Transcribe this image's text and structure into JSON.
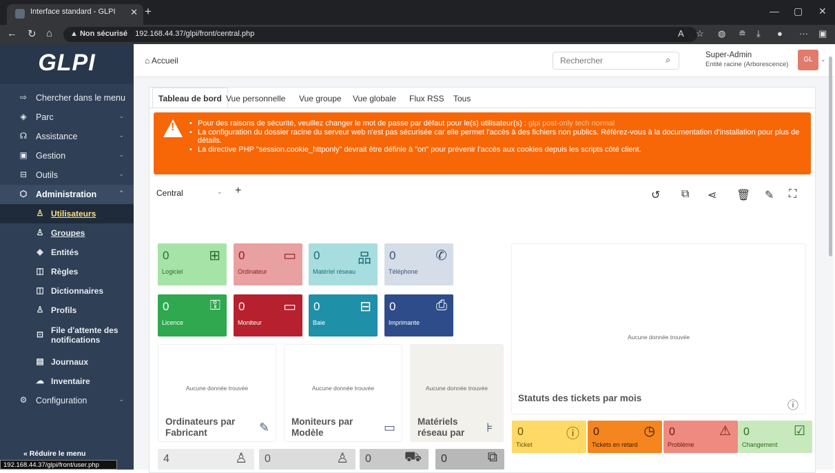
{
  "browser": {
    "tab_title": "Interface standard - GLPI",
    "url_prefix": "Non sécurisé",
    "url": "192.168.44.37/glpi/front/central.php",
    "status_url": "192.168.44.37/glpi/front/user.php"
  },
  "sidebar": {
    "logo": "GLPI",
    "search_label": "Chercher dans le menu",
    "items": [
      {
        "label": "Parc"
      },
      {
        "label": "Assistance"
      },
      {
        "label": "Gestion"
      },
      {
        "label": "Outils"
      },
      {
        "label": "Administration"
      }
    ],
    "admin_sub": [
      {
        "label": "Utilisateurs"
      },
      {
        "label": "Groupes"
      },
      {
        "label": "Entités"
      },
      {
        "label": "Règles"
      },
      {
        "label": "Dictionnaires"
      },
      {
        "label": "Profils"
      },
      {
        "label": "File d'attente des notifications"
      },
      {
        "label": "Journaux"
      },
      {
        "label": "Inventaire"
      }
    ],
    "config_label": "Configuration",
    "reduce_label": "Réduire le menu"
  },
  "header": {
    "breadcrumb": "Accueil",
    "search_placeholder": "Rechercher",
    "user_name": "Super-Admin",
    "user_entity": "Entité racine (Arborescence)",
    "avatar_initials": "GL"
  },
  "tabs": [
    "Tableau de bord",
    "Vue personnelle",
    "Vue groupe",
    "Vue globale",
    "Flux RSS",
    "Tous"
  ],
  "alert": {
    "line1_pre": "Pour des raisons de sécurité, veuillez changer le mot de passe par défaut pour le(s) utilisateur(s) :",
    "line1_users": "glpi post-only tech normal",
    "line2": "La configuration du dossier racine du serveur web n'est pas sécurisée car elle permet l'accès à des fichiers non publics. Référez-vous à la documentation d'installation pour plus de détails.",
    "line3": "La directive PHP \"session.cookie_httponly\" devrait être définie à \"on\" pour prévenir l'accès aux cookies depuis les scripts côté client."
  },
  "dashboard": {
    "selected": "Central",
    "tiles": [
      {
        "value": "0",
        "label": "Logiciel",
        "color": "#a6e3a6"
      },
      {
        "value": "0",
        "label": "Ordinateur",
        "color": "#e8a0a0"
      },
      {
        "value": "0",
        "label": "Matériel réseau",
        "color": "#a8dde0"
      },
      {
        "value": "0",
        "label": "Téléphone",
        "color": "#d4dde8"
      },
      {
        "value": "0",
        "label": "Licence",
        "color": "#2fa84f"
      },
      {
        "value": "0",
        "label": "Moniteur",
        "color": "#b7202e"
      },
      {
        "value": "0",
        "label": "Baie",
        "color": "#1e90a8"
      },
      {
        "value": "0",
        "label": "Imprimante",
        "color": "#2e4c8a"
      }
    ],
    "empty_msg": "Aucune donnée trouvée",
    "cards": [
      {
        "title": "Ordinateurs par Fabricant"
      },
      {
        "title": "Moniteurs par Modèle"
      },
      {
        "title": "Matériels réseau par"
      }
    ],
    "big_chart_title": "Statuts des tickets par mois",
    "ticket_tiles": [
      {
        "value": "0",
        "label": "Ticket",
        "color": "#ffd966"
      },
      {
        "value": "0",
        "label": "Tickets en retard",
        "color": "#f5851f"
      },
      {
        "value": "0",
        "label": "Problème",
        "color": "#ef8a80"
      },
      {
        "value": "0",
        "label": "Changement",
        "color": "#c8e8bd"
      }
    ],
    "grey_tiles": [
      {
        "value": "4"
      },
      {
        "value": "0"
      },
      {
        "value": "0"
      },
      {
        "value": "0"
      }
    ]
  }
}
